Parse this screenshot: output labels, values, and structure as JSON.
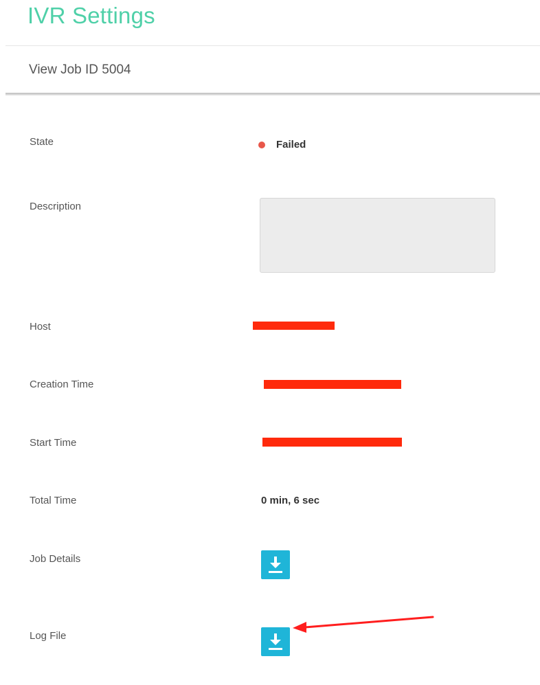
{
  "app": {
    "title": "IVR Settings"
  },
  "subheader": {
    "title": "View Job ID 5004"
  },
  "fields": {
    "state": {
      "label": "State",
      "value": "Failed",
      "status_color": "#e8574a"
    },
    "description": {
      "label": "Description",
      "value": ""
    },
    "host": {
      "label": "Host"
    },
    "creation_time": {
      "label": "Creation Time"
    },
    "start_time": {
      "label": "Start Time"
    },
    "total_time": {
      "label": "Total Time",
      "value": "0 min, 6 sec"
    },
    "job_details": {
      "label": "Job Details",
      "icon": "download-icon"
    },
    "log_file": {
      "label": "Log File",
      "icon": "download-icon"
    }
  },
  "colors": {
    "title_accent": "#4fd0a8",
    "download_button": "#1fb5d8",
    "redaction": "#ff2a0c",
    "annotation_arrow": "#ff1e1e"
  }
}
